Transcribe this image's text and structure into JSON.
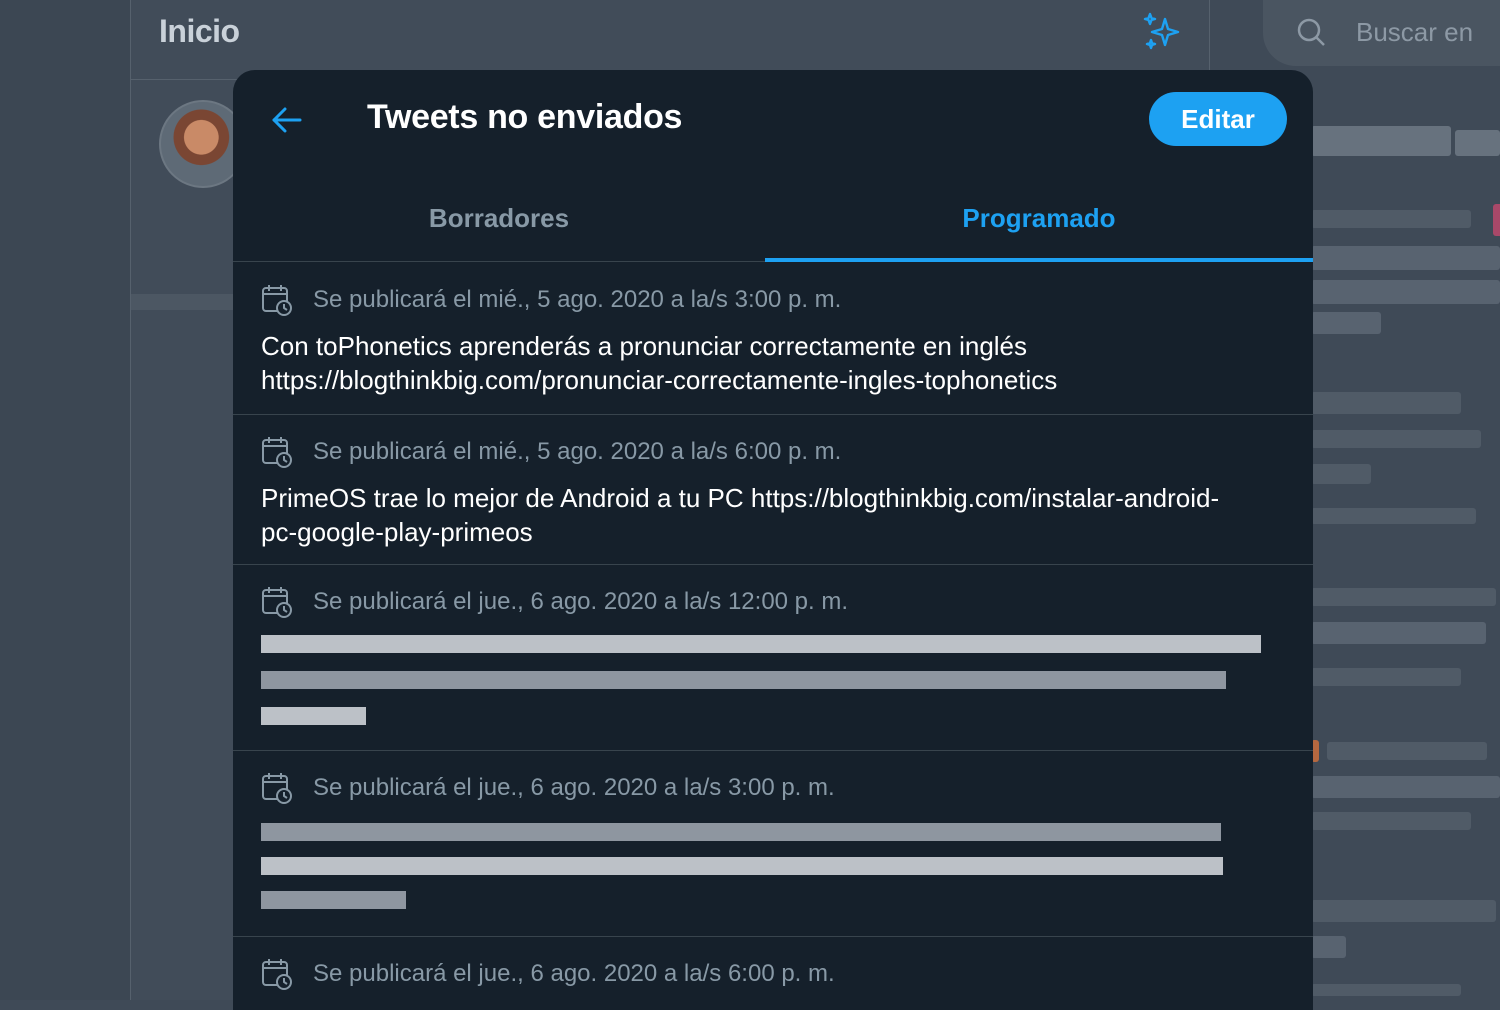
{
  "background": {
    "main_title": "Inicio",
    "search_placeholder": "Buscar en"
  },
  "modal": {
    "title": "Tweets no enviados",
    "edit_label": "Editar",
    "tabs": [
      {
        "label": "Borradores",
        "selected": false
      },
      {
        "label": "Programado",
        "selected": true
      }
    ],
    "items": [
      {
        "schedule": "Se publicará el mié., 5 ago. 2020 a la/s 3:00 p. m.",
        "text": "Con toPhonetics aprenderás a pronunciar correctamente en inglés https://blogthinkbig.com/pronunciar-correctamente-ingles-tophonetics",
        "redacted": false
      },
      {
        "schedule": "Se publicará el mié., 5 ago. 2020 a la/s 6:00 p. m.",
        "text": "PrimeOS trae lo mejor de Android a tu PC https://blogthinkbig.com/instalar-android-pc-google-play-primeos",
        "redacted": false
      },
      {
        "schedule": "Se publicará el jue., 6 ago. 2020 a la/s 12:00 p. m.",
        "text": "",
        "redacted": true
      },
      {
        "schedule": "Se publicará el jue., 6 ago. 2020 a la/s 3:00 p. m.",
        "text": "",
        "redacted": true
      },
      {
        "schedule": "Se publicará el jue., 6 ago. 2020 a la/s 6:00 p. m.",
        "text": "",
        "redacted": true
      }
    ]
  },
  "colors": {
    "accent": "#1da1f2",
    "modal_bg": "#15202b",
    "muted_text": "#8899a6",
    "border": "#38444d"
  },
  "icons": {
    "back": "arrow-left-icon",
    "sparkle": "sparkle-icon",
    "search": "search-icon",
    "calendar": "calendar-clock-icon"
  }
}
